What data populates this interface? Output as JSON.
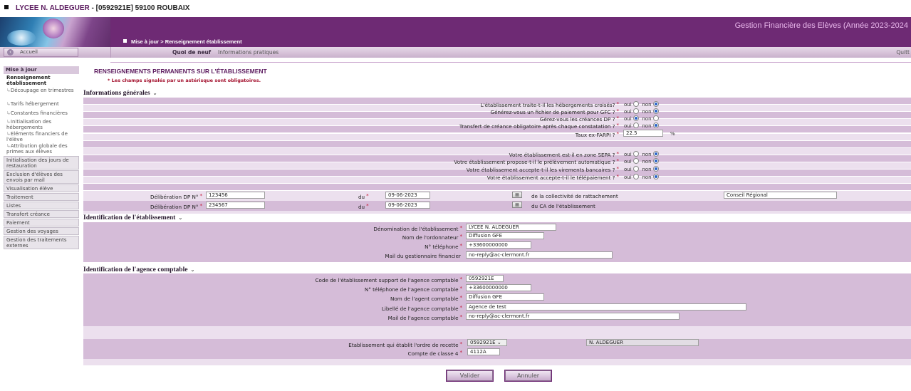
{
  "top": {
    "label": "LYCEE N. ALDEGUER",
    "suffix": " - [0592921E] 59100 ROUBAIX"
  },
  "header": {
    "app_title": "Gestion Financière des Elèves  (Année 2023-2024",
    "breadcrumb": "Mise à jour  >  Renseignement établissement"
  },
  "nav": {
    "accueil": "Accueil",
    "quoi_de_neuf": "Quoi de neuf",
    "infos": "Informations pratiques",
    "quit": "Quitt"
  },
  "sidebar": {
    "head": "Mise à jour",
    "subs": [
      "Renseignement établissement",
      "Découpage en trimestres",
      "Tarifs hébergement",
      "Constantes financières",
      "Initialisation des hébergements",
      "Eléments financiers de l'élève",
      "Attribution globale des primes aux élèves"
    ],
    "buttons": [
      "Initialisation des jours de restauration",
      "Exclusion d'élèves des envois par mail",
      "Visualisation élève",
      "Traitement",
      "Listes",
      "Transfert créance",
      "Paiement",
      "Gestion des voyages",
      "Gestion des traitements externes"
    ]
  },
  "page": {
    "title": "RENSEIGNEMENTS PERMANENTS SUR L'ÉTABLISSEMENT",
    "note": "* Les champs signalés par un astérisque sont obligatoires."
  },
  "general": {
    "title": "Informations générales",
    "q1": "L'établissement traite-t-il les hébergements croisés?",
    "q2": "Générez-vous un fichier de paiement pour GFC ?",
    "q3": "Gérez-vous les créances DP ?",
    "q4": "Transfert de créance obligatoire après chaque constatation ?",
    "farpi_label": "Taux ex-FARPI ?",
    "farpi_value": "22.5",
    "pct": "%",
    "q5": "Votre établissement est-il en zone SEPA ?",
    "q6": "Votre établissement propose-t-il le prélèvement automatique ?",
    "q7": "Votre établissement accepte-t-il les virements bancaires ?",
    "q8": "Votre établissement accepte-t-il le télépaiement ?",
    "oui": "oui",
    "non": "non",
    "delib_label": "Délibération DP N°",
    "du": "du",
    "delib1": "123456",
    "date1": "09-06-2023",
    "coll_label": "de la collectivité de rattachement",
    "coll_value": "Conseil Régional",
    "delib2": "234567",
    "date2": "09-06-2023",
    "ca_label": "du CA de l'établissement"
  },
  "ident": {
    "title": "Identification de l'établissement",
    "denom_label": "Dénomination de l'établissement",
    "denom": "LYCEE N. ALDEGUER",
    "ordo_label": "Nom de l'ordonnateur",
    "ordo": "Diffusion GFE",
    "tel_label": "N° téléphone",
    "tel": "+33600000000",
    "mail_label": "Mail du gestionnaire financier",
    "mail": "no-reply@ac-clermont.fr"
  },
  "agence": {
    "title": "Identification de l'agence comptable",
    "code_label": "Code de l'établissement support de l'agence comptable",
    "code": "0592921E",
    "tel_label": "N° téléphone de l'agence comptable",
    "tel": "+33600000000",
    "nom_label": "Nom de l'agent comptable",
    "nom": "Diffusion GFE",
    "lib_label": "Libellé de l'agence comptable",
    "lib": "Agence de test",
    "mail_label": "Mail de l'agence comptable",
    "mail": "no-reply@ac-clermont.fr",
    "ordre_label": "Etablissement qui établit l'ordre de recette",
    "ordre_sel": "0592921E",
    "ordre_name": "N. ALDEGUER",
    "classe_label": "Compte de classe 4",
    "classe": "4112A"
  },
  "buttons": {
    "valider": "Valider",
    "annuler": "Annuler"
  },
  "colors": {
    "header": "#6e2a74",
    "band_dark": "#d5bcd8",
    "band_light": "#ece0ee",
    "title": "#5b1a5e",
    "required": "#c0102d"
  }
}
